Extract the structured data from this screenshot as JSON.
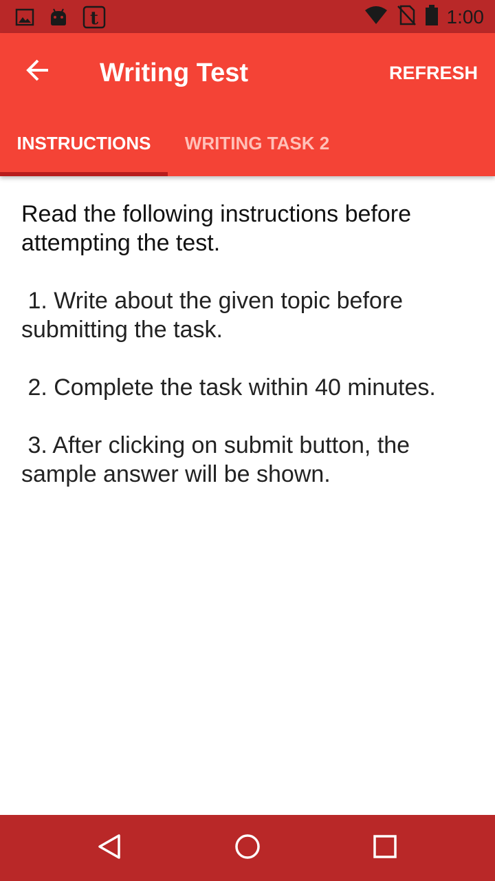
{
  "status_bar": {
    "time": "1:00",
    "left_icons": [
      "image-icon",
      "android-icon",
      "tumblr-icon"
    ],
    "right_icons": [
      "wifi-icon",
      "no-sim-icon",
      "battery-icon"
    ]
  },
  "app_bar": {
    "title": "Writing Test",
    "refresh_label": "REFRESH",
    "background_color": "#f44336"
  },
  "tabs": [
    {
      "label": "INSTRUCTIONS",
      "selected": true
    },
    {
      "label": "WRITING TASK 2",
      "selected": false
    }
  ],
  "content": {
    "heading": "Read the following instructions before attempting the test.",
    "items": [
      " 1. Write about the given topic before submitting the task.",
      " 2. Complete the task within 40 minutes.",
      " 3. After clicking on submit button, the sample answer will be shown."
    ]
  },
  "nav_bar": {
    "buttons": [
      "back-nav-icon",
      "home-icon",
      "recents-icon"
    ]
  }
}
